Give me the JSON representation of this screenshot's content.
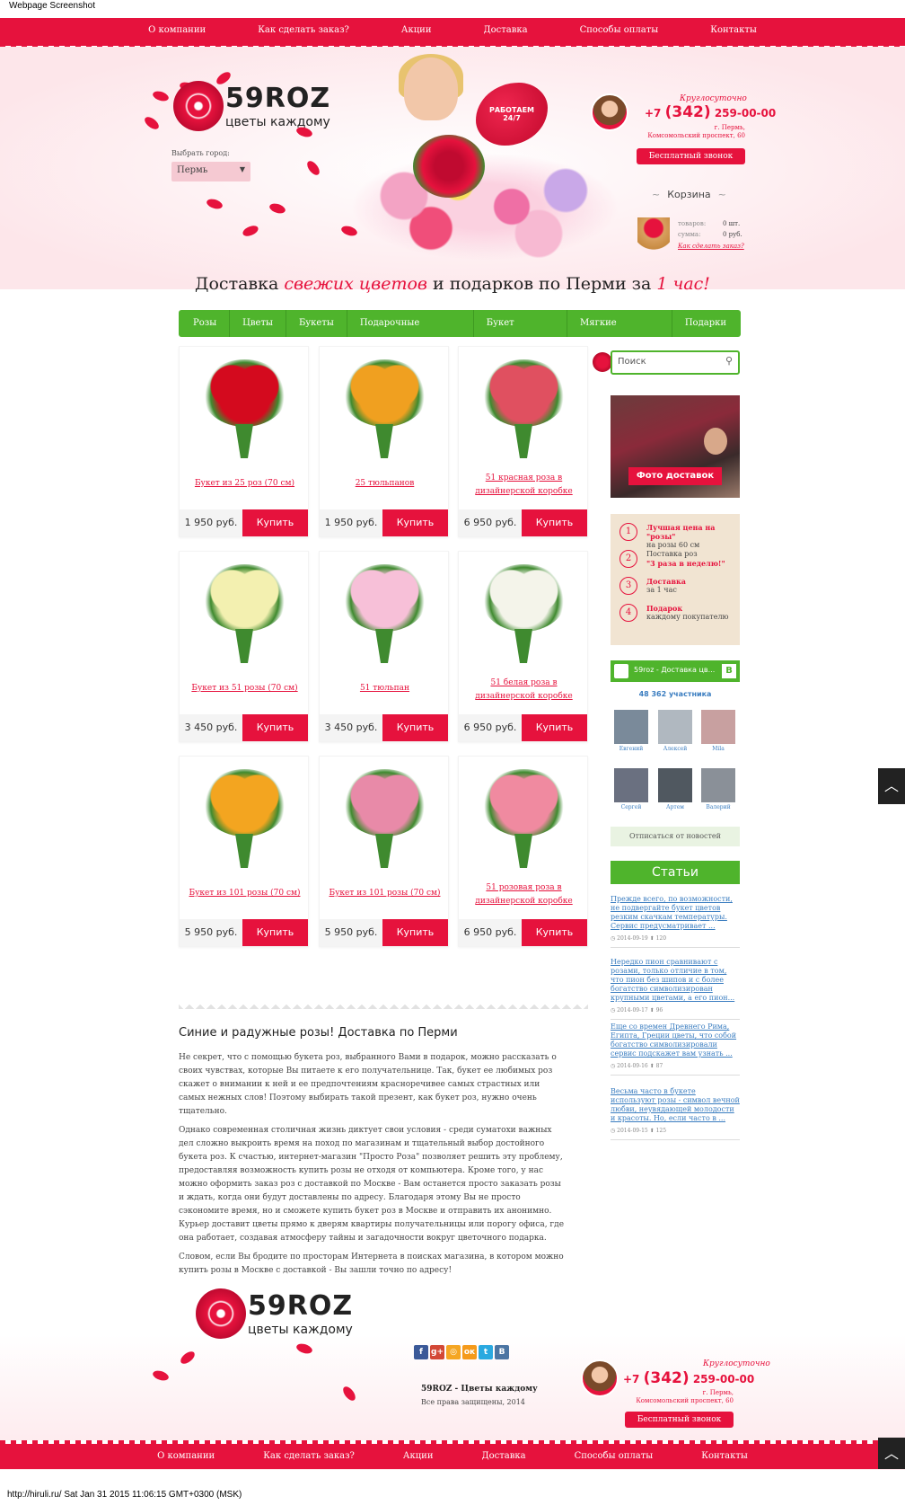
{
  "caption": "Webpage Screenshot",
  "topnav": [
    "О компании",
    "Как сделать заказ?",
    "Акции",
    "Доставка",
    "Способы оплаты",
    "Контакты"
  ],
  "logo": {
    "title": "59ROZ",
    "subtitle": "цветы каждому"
  },
  "city": {
    "label": "Выбрать город:",
    "value": "Пермь",
    "arrow": "▼"
  },
  "hero": {
    "badge": "РАБОТАЕМ 24/7"
  },
  "contact": {
    "round_clock": "Круглосуточно",
    "phone_prefix": "+7",
    "phone_code": "(342)",
    "phone_number": "259-00-00",
    "address_line1": "г. Пермь,",
    "address_line2": "Комсомольский проспект, 60",
    "callback": "Бесплатный звонок"
  },
  "cart": {
    "title": "Корзина",
    "items_label": "товаров:",
    "items_value": "0 шт.",
    "sum_label": "сумма:",
    "sum_value": "0 руб.",
    "how_to": "Как сделать заказ?"
  },
  "slogan": {
    "part1": "Доставка ",
    "accent1": "свежих цветов",
    "part2": " и подарков по Перми за ",
    "accent2": "1 час!"
  },
  "green_nav": [
    "Розы",
    "Цветы",
    "Букеты",
    "Подарочные корзины",
    "Букет невесты",
    "Мягкие игрушки",
    "Подарки"
  ],
  "products": [
    {
      "name": "Букет из 25 роз (70 см)",
      "price": "1 950 руб.",
      "buy": "Купить",
      "color": "#d40a1e",
      "icon": "red-roses-bouquet-icon"
    },
    {
      "name": "25 тюльпанов",
      "price": "1 950 руб.",
      "buy": "Купить",
      "color": "#f0a020",
      "icon": "tulips-bouquet-icon"
    },
    {
      "name": "51 красная роза в дизайнерской коробке",
      "price": "6 950 руб.",
      "buy": "Купить",
      "color": "#e05060",
      "icon": "roses-box-icon"
    },
    {
      "name": "Букет из 51 розы (70 см)",
      "price": "3 450 руб.",
      "buy": "Купить",
      "color": "#f3f0b0",
      "icon": "white-roses-bouquet-icon"
    },
    {
      "name": "51 тюльпан",
      "price": "3 450 руб.",
      "buy": "Купить",
      "color": "#f7c0d8",
      "icon": "white-tulips-bouquet-icon"
    },
    {
      "name": "51 белая роза в дизайнерской коробке",
      "price": "6 950 руб.",
      "buy": "Купить",
      "color": "#f4f4ea",
      "icon": "white-roses-basket-icon"
    },
    {
      "name": "Букет из 101 розы (70 см)",
      "price": "5 950 руб.",
      "buy": "Купить",
      "color": "#f3a520",
      "icon": "orange-roses-bouquet-icon"
    },
    {
      "name": "Букет из 101 розы (70 см)",
      "price": "5 950 руб.",
      "buy": "Купить",
      "color": "#e88aa8",
      "icon": "pink-roses-bouquet-icon"
    },
    {
      "name": "51 розовая роза в дизайнерской коробке",
      "price": "6 950 руб.",
      "buy": "Купить",
      "color": "#f08aa0",
      "icon": "pink-roses-basket-icon"
    }
  ],
  "article": {
    "title": "Синие и радужные розы! Доставка по Перми",
    "p1": "Не секрет, что с помощью букета роз, выбранного Вами в подарок, можно рассказать о своих чувствах, которые Вы питаете к его получательнице. Так, букет ее любимых роз скажет о внимании к ней и ее предпочтениям красноречивее самых страстных или самых нежных слов! Поэтому выбирать такой презент, как букет роз, нужно очень тщательно.",
    "p2": "Однако современная столичная жизнь диктует свои условия - среди суматохи важных дел сложно выкроить время на поход по магазинам и тщательный выбор достойного букета роз. К счастью, интернет-магазин \"Просто Роза\" позволяет решить эту проблему, предоставляя возможность купить розы не отходя от компьютера. Кроме того, у нас можно оформить заказ роз с доставкой по Москве - Вам останется просто заказать розы и ждать, когда они будут доставлены по адресу. Благодаря этому Вы не просто сэкономите время, но и сможете купить букет роз в Москве и отправить их анонимно. Курьер доставит цветы прямо к дверям квартиры получательницы или порогу офиса, где она работает, создавая атмосферу тайны и загадочности вокруг цветочного подарка.",
    "p3": "Словом, если Вы бродите по просторам Интернета в поисках магазина, в котором можно купить розы в Москве с доставкой - Вы зашли точно по адресу!"
  },
  "sidebar": {
    "search_placeholder": "Поиск",
    "photo_button": "Фото доставок",
    "benefits": [
      {
        "num": "1",
        "bold": "Лучшая цена на \"розы\"",
        "text": "на розы 60 см"
      },
      {
        "num": "2",
        "bold": "Поставка роз",
        "text": "\"3 раза в неделю!\""
      },
      {
        "num": "3",
        "bold": "Доставка",
        "text": "за 1 час"
      },
      {
        "num": "4",
        "bold": "Подарок",
        "text": "каждому покупателю"
      }
    ],
    "vk_title": "59roz - Доставка цв...",
    "vk_button": "В",
    "vk_count": "48 362 участника",
    "members": [
      "Евгений",
      "Алексей",
      "Mila",
      "Сергей",
      "Артем",
      "Валерий"
    ],
    "unsubscribe": "Отписаться от новостей",
    "articles_title": "Статьи",
    "articles": [
      {
        "text": "Прежде всего, по возможности, не подвергайте букет цветов резким скачкам температуры. Сервис предусматривает ...",
        "date": "2014-09-19",
        "views": "120"
      },
      {
        "text": "Нередко пион сравнивают с розами, только отличие в том, что пион без шипов и с более богатство символизирован крупными цветами, а его пион...",
        "date": "2014-09-17",
        "views": "96"
      },
      {
        "text": "Еще со времен Древнего Рима, Египта, Греции цветы, что собой богатство символизировали сервис подскажет вам узнать ...",
        "date": "2014-09-16",
        "views": "87"
      },
      {
        "text": "Весьма часто в букете используют розы - символ вечной любви, неувядающей молодости и красоты. Но, если часто в ...",
        "date": "2014-09-15",
        "views": "125"
      }
    ]
  },
  "footer": {
    "social": [
      "f",
      "g+",
      "◎",
      "ок",
      "t",
      "В"
    ],
    "name": "59ROZ - Цветы каждому",
    "copyright": "Все права защищены, 2014",
    "nav": [
      "О компании",
      "Как сделать заказ?",
      "Акции",
      "Доставка",
      "Способы оплаты",
      "Контакты"
    ]
  },
  "scroll_top": "︿",
  "statusbar": "http://hiruli.ru/ Sat Jan 31 2015 11:06:15 GMT+0300 (MSK)"
}
